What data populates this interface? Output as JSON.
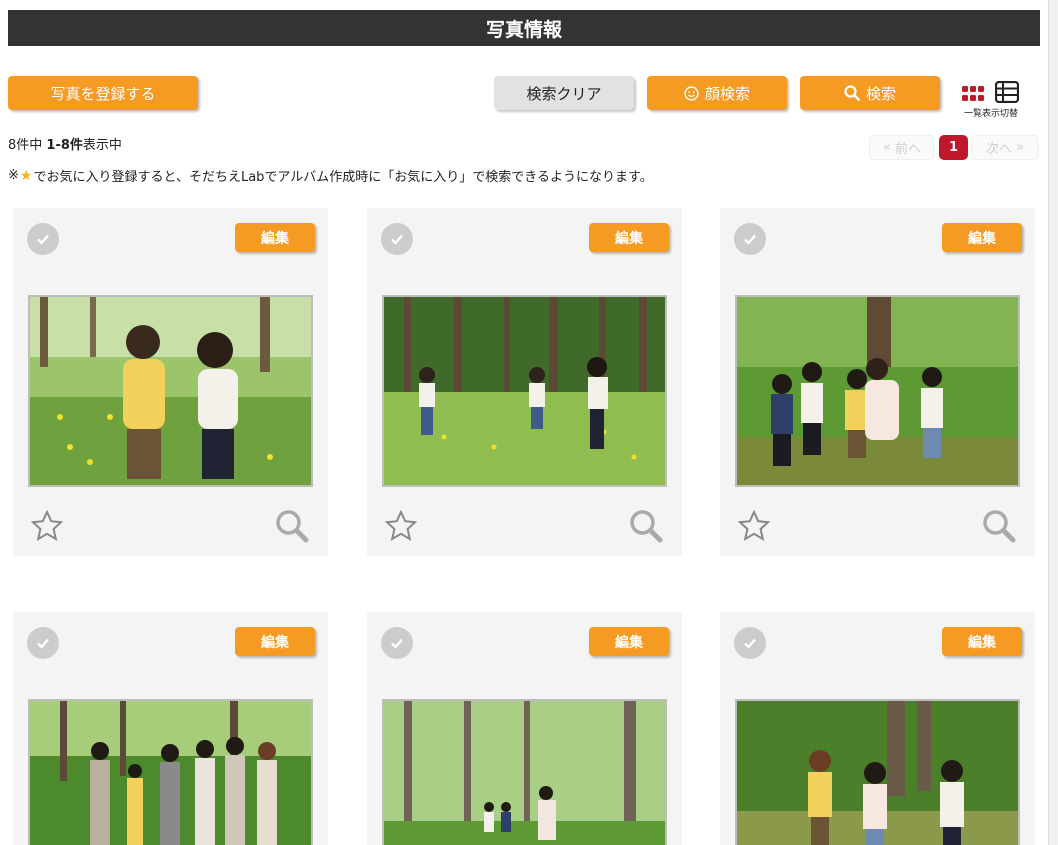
{
  "header": {
    "title": "写真情報"
  },
  "toolbar": {
    "register_label": "写真を登録する",
    "clear_label": "検索クリア",
    "face_search_label": "顔検索",
    "search_label": "検索",
    "view_toggle_label": "一覧表示切替"
  },
  "summary": {
    "total_prefix": "8件中 ",
    "range": "1-8件",
    "suffix": "表示中"
  },
  "note": {
    "prefix": "※",
    "text": "でお気に入り登録すると、そだちえLabでアルバム作成時に「お気に入り」で検索できるようになります。"
  },
  "pagination": {
    "prev_label": "前へ",
    "current_page": "1",
    "next_label": "次へ"
  },
  "cards": [
    {
      "edit_label": "編集",
      "scene": "two children holding hands among yellow flowers"
    },
    {
      "edit_label": "編集",
      "scene": "three toddlers walking on grass in forest"
    },
    {
      "edit_label": "編集",
      "scene": "group of children with teacher on green slope"
    },
    {
      "edit_label": "編集",
      "scene": "group photo of adults holding children in forest"
    },
    {
      "edit_label": "編集",
      "scene": "children and adult playing among tall trees"
    },
    {
      "edit_label": "編集",
      "scene": "three toddlers walking in green woods"
    }
  ],
  "colors": {
    "accent": "#f59a23",
    "header_bg": "#333333",
    "current_page": "#c0182a",
    "card_bg": "#f4f4f4",
    "view_icon_active": "#c0182a"
  }
}
